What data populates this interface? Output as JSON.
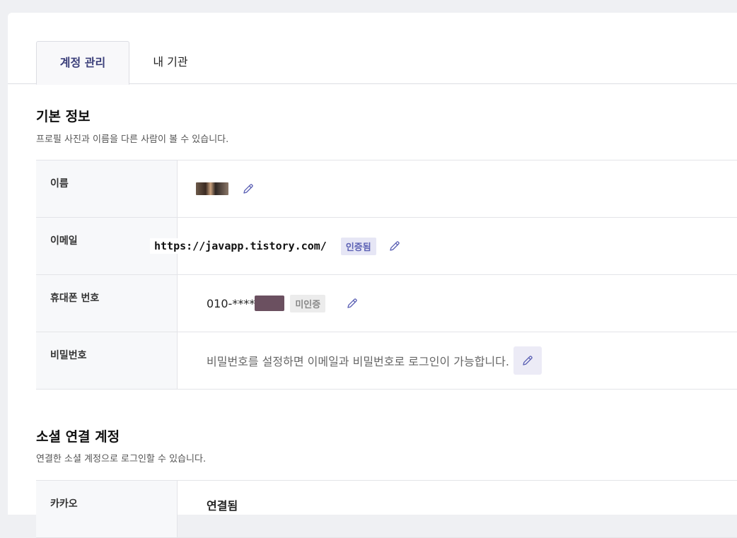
{
  "tabs": [
    {
      "label": "계정 관리",
      "active": true
    },
    {
      "label": "내 기관",
      "active": false
    }
  ],
  "basic_info": {
    "title": "기본 정보",
    "desc": "프로필 사진과 이름을 다른 사람이 볼 수 있습니다.",
    "rows": {
      "name": {
        "label": "이름"
      },
      "email": {
        "label": "이메일",
        "value": "https://javapp.tistory.com/",
        "badge": "인증됨"
      },
      "phone": {
        "label": "휴대폰 번호",
        "value": "010-****",
        "badge": "미인증"
      },
      "password": {
        "label": "비밀번호",
        "value": "비밀번호를 설정하면 이메일과 비밀번호로 로그인이 가능합니다."
      }
    }
  },
  "social": {
    "title": "소셜 연결 계정",
    "desc": "연결한 소셜 계정으로 로그인할 수 있습니다.",
    "rows": {
      "kakao": {
        "label": "카카오",
        "value": "연결됨"
      }
    }
  },
  "colors": {
    "accent": "#3b3f7a",
    "pencil": "#5d62b5",
    "badge_verified_bg": "#e6e6f5",
    "badge_unverified_bg": "#ececec"
  },
  "icons": {
    "edit": "pencil-icon"
  }
}
